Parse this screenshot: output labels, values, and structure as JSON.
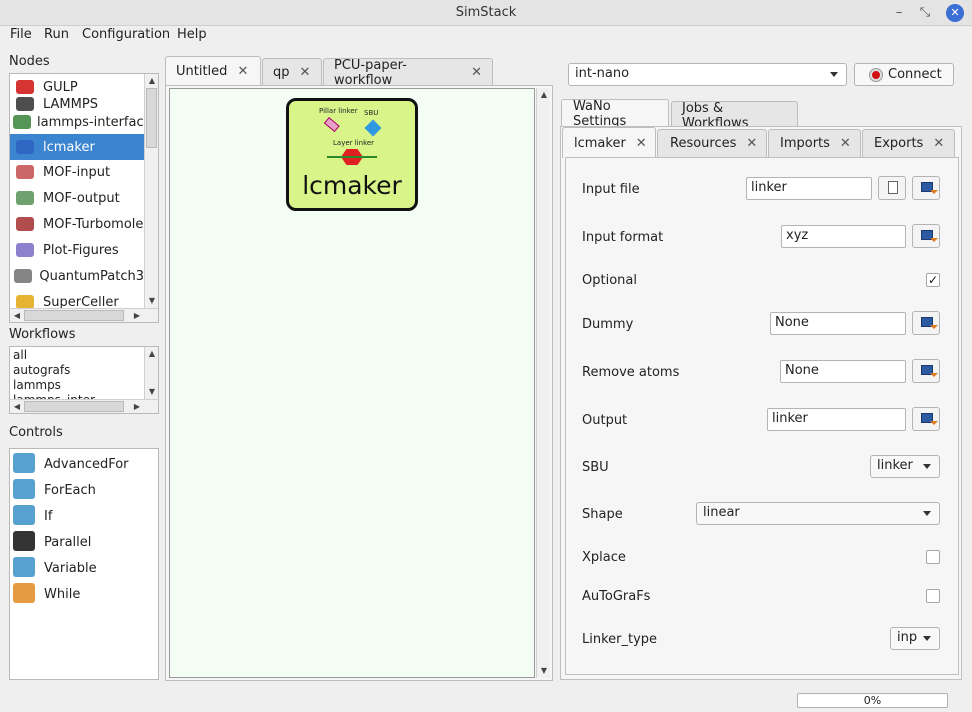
{
  "window": {
    "title": "SimStack"
  },
  "menu": [
    "File",
    "Run",
    "Configuration",
    "Help"
  ],
  "nodes": {
    "label": "Nodes",
    "items": [
      {
        "name": "GULP",
        "icon": "gulp-icon"
      },
      {
        "name": "LAMMPS",
        "icon": "lammps-icon"
      },
      {
        "name": "lammps-interface",
        "icon": "lammps-interface-icon"
      },
      {
        "name": "lcmaker",
        "icon": "lcmaker-icon"
      },
      {
        "name": "MOF-input",
        "icon": "mof-input-icon"
      },
      {
        "name": "MOF-output",
        "icon": "mof-output-icon"
      },
      {
        "name": "MOF-Turbomole",
        "icon": "mof-turbomole-icon"
      },
      {
        "name": "Plot-Figures",
        "icon": "plot-figures-icon"
      },
      {
        "name": "QuantumPatch3",
        "icon": "quantumpatch-icon"
      },
      {
        "name": "SuperCeller",
        "icon": "superceller-icon"
      }
    ]
  },
  "workflows": {
    "label": "Workflows",
    "items": [
      "all",
      "autografs",
      "lammps",
      "lammps_inter"
    ]
  },
  "controls": {
    "label": "Controls",
    "items": [
      "AdvancedFor",
      "ForEach",
      "If",
      "Parallel",
      "Variable",
      "While"
    ]
  },
  "editor_tabs": [
    "Untitled",
    "qp",
    "PCU-paper-workflow"
  ],
  "canvas_node": {
    "title": "lcmaker",
    "labels": [
      "Pillar linker",
      "SBU",
      "Layer linker"
    ]
  },
  "server": {
    "selected": "int-nano",
    "connect_label": "Connect"
  },
  "right_tabs": [
    "WaNo Settings",
    "Jobs & Workflows"
  ],
  "wano_tabs": [
    "lcmaker",
    "Resources",
    "Imports",
    "Exports"
  ],
  "settings": {
    "input_file": {
      "label": "Input file",
      "value": "linker"
    },
    "input_format": {
      "label": "Input format",
      "value": "xyz"
    },
    "optional": {
      "label": "Optional",
      "checked": true,
      "mark": "✓"
    },
    "dummy": {
      "label": "Dummy",
      "value": "None"
    },
    "remove_atoms": {
      "label": "Remove atoms",
      "value": "None"
    },
    "output": {
      "label": "Output",
      "value": "linker"
    },
    "sbu": {
      "label": "SBU",
      "value": "linker"
    },
    "shape": {
      "label": "Shape",
      "value": "linear"
    },
    "xplace": {
      "label": "Xplace",
      "checked": false
    },
    "autografs": {
      "label": "AuToGraFs",
      "checked": false
    },
    "linker_type": {
      "label": "Linker_type",
      "value": "inp"
    }
  },
  "progress": {
    "value": 0,
    "text": "0%"
  }
}
